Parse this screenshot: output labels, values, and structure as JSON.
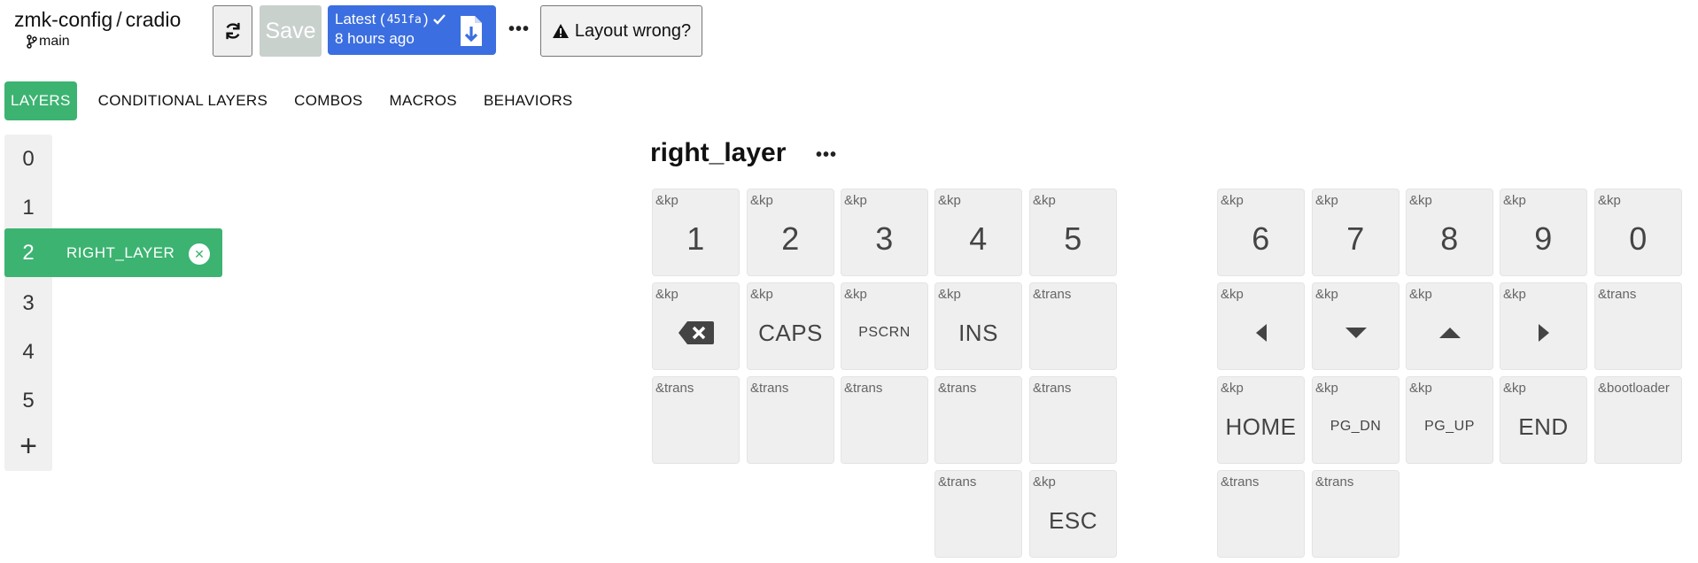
{
  "header": {
    "repo": "zmk-config",
    "separator": "/",
    "keyboard": "cradio",
    "branch": "main",
    "save_label": "Save",
    "latest_prefix": "Latest (",
    "latest_hash": "451fa",
    "latest_suffix": ")",
    "latest_time": "8 hours ago",
    "more_label": "•••",
    "layout_wrong_label": "Layout wrong?"
  },
  "tabs": [
    {
      "label": "LAYERS",
      "active": true
    },
    {
      "label": "CONDITIONAL LAYERS"
    },
    {
      "label": "COMBOS"
    },
    {
      "label": "MACROS"
    },
    {
      "label": "BEHAVIORS"
    }
  ],
  "layers": {
    "items": [
      {
        "index": "0"
      },
      {
        "index": "1"
      },
      {
        "index": "2",
        "name": "RIGHT_LAYER",
        "active": true
      },
      {
        "index": "3"
      },
      {
        "index": "4"
      },
      {
        "index": "5"
      }
    ],
    "add_label": "+",
    "close_label": "✕"
  },
  "layer_title": "right_layer",
  "layer_more_label": "•••",
  "keys": [
    {
      "behavior": "&kp",
      "label": "1",
      "style": "big"
    },
    {
      "behavior": "&kp",
      "label": "2",
      "style": "big"
    },
    {
      "behavior": "&kp",
      "label": "3",
      "style": "big"
    },
    {
      "behavior": "&kp",
      "label": "4",
      "style": "big"
    },
    {
      "behavior": "&kp",
      "label": "5",
      "style": "big"
    },
    {
      "behavior": "&kp",
      "label": "6",
      "style": "big"
    },
    {
      "behavior": "&kp",
      "label": "7",
      "style": "big"
    },
    {
      "behavior": "&kp",
      "label": "8",
      "style": "big"
    },
    {
      "behavior": "&kp",
      "label": "9",
      "style": "big"
    },
    {
      "behavior": "&kp",
      "label": "0",
      "style": "big"
    },
    {
      "behavior": "&kp",
      "label": "",
      "icon": "backspace-icon"
    },
    {
      "behavior": "&kp",
      "label": "CAPS"
    },
    {
      "behavior": "&kp",
      "label": "PSCRN",
      "style": "small"
    },
    {
      "behavior": "&kp",
      "label": "INS"
    },
    {
      "behavior": "&trans",
      "label": ""
    },
    {
      "behavior": "&kp",
      "label": "",
      "icon": "arrow-left-icon"
    },
    {
      "behavior": "&kp",
      "label": "",
      "icon": "arrow-down-icon"
    },
    {
      "behavior": "&kp",
      "label": "",
      "icon": "arrow-up-icon"
    },
    {
      "behavior": "&kp",
      "label": "",
      "icon": "arrow-right-icon"
    },
    {
      "behavior": "&trans",
      "label": ""
    },
    {
      "behavior": "&trans",
      "label": ""
    },
    {
      "behavior": "&trans",
      "label": ""
    },
    {
      "behavior": "&trans",
      "label": ""
    },
    {
      "behavior": "&trans",
      "label": ""
    },
    {
      "behavior": "&trans",
      "label": ""
    },
    {
      "behavior": "&kp",
      "label": "HOME"
    },
    {
      "behavior": "&kp",
      "label": "PG_DN",
      "style": "small"
    },
    {
      "behavior": "&kp",
      "label": "PG_UP",
      "style": "small"
    },
    {
      "behavior": "&kp",
      "label": "END"
    },
    {
      "behavior": "&bootloader",
      "label": ""
    },
    {
      "behavior": "&trans",
      "label": ""
    },
    {
      "behavior": "&kp",
      "label": "ESC"
    },
    {
      "behavior": "&trans",
      "label": ""
    },
    {
      "behavior": "&trans",
      "label": ""
    }
  ],
  "colors": {
    "accent": "#3cb371",
    "primary": "#3b6ee0",
    "key_bg": "#efefef"
  }
}
